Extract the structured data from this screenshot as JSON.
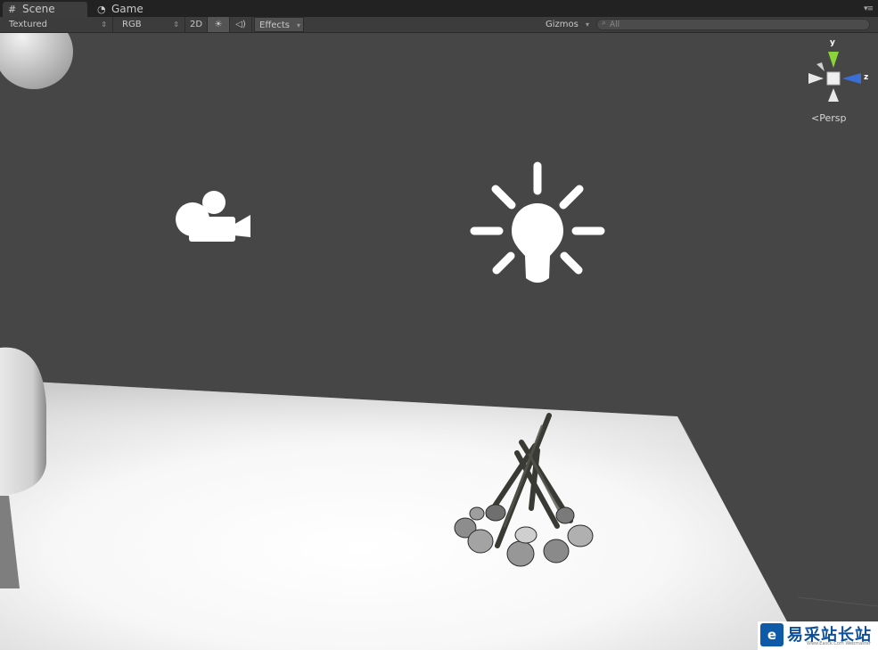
{
  "tabs": [
    {
      "label": "Scene",
      "icon": "grid-icon",
      "active": true
    },
    {
      "label": "Game",
      "icon": "pacman-icon",
      "active": false
    }
  ],
  "toolbar": {
    "shading_mode": "Textured",
    "render_mode": "RGB",
    "toggle_2d": "2D",
    "effects_label": "Effects",
    "gizmos_label": "Gizmos",
    "search_placeholder": "All"
  },
  "scene_gizmo": {
    "y_label": "y",
    "z_label": "z",
    "projection": "Persp",
    "colors": {
      "y": "#8ad33a",
      "z": "#3a6fd8"
    }
  },
  "watermark": {
    "logo": "e",
    "text": "易采站长站",
    "subtitle": "Www.Easck.Com Webmaster"
  },
  "colors": {
    "scene_background": "#464646",
    "tab_bar": "#222222",
    "toolbar": "#3c3c3c"
  }
}
